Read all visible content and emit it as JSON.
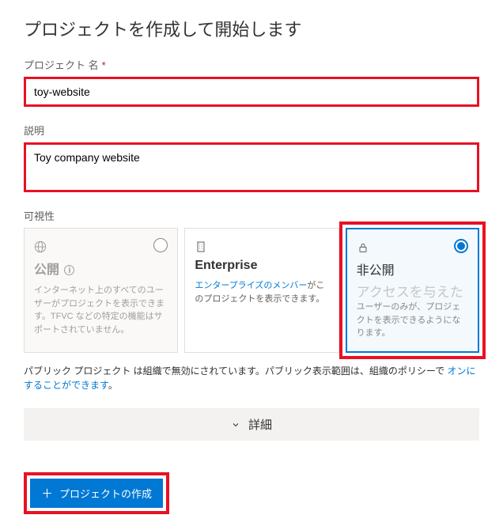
{
  "title": "プロジェクトを作成して開始します",
  "projectName": {
    "label": "プロジェクト 名",
    "value": "toy-website"
  },
  "description": {
    "label": "説明",
    "value": "Toy company website"
  },
  "visibility": {
    "label": "可視性",
    "public": {
      "title": "公開",
      "desc": "インターネット上のすべてのユーザーがプロジェクトを表示できます。TFVC などの特定の機能はサポートされていません。"
    },
    "enterprise": {
      "title": "Enterprise",
      "linkText": "エンタープライズのメンバー",
      "descSuffix": "がこのプロジェクトを表示できます。"
    },
    "private": {
      "title": "非公開",
      "subtitle": "アクセスを与えた",
      "desc": "ユーザーのみが、プロジェクトを表示できるようになります。"
    }
  },
  "policyNote": {
    "textBefore": "パブリック プロジェクト は組織で無効にされています。パブリック表示範囲は、組織のポリシーで",
    "linkText": "オンにすることができます",
    "textAfter": "。"
  },
  "detailsLabel": "詳細",
  "createButton": "プロジェクトの作成"
}
